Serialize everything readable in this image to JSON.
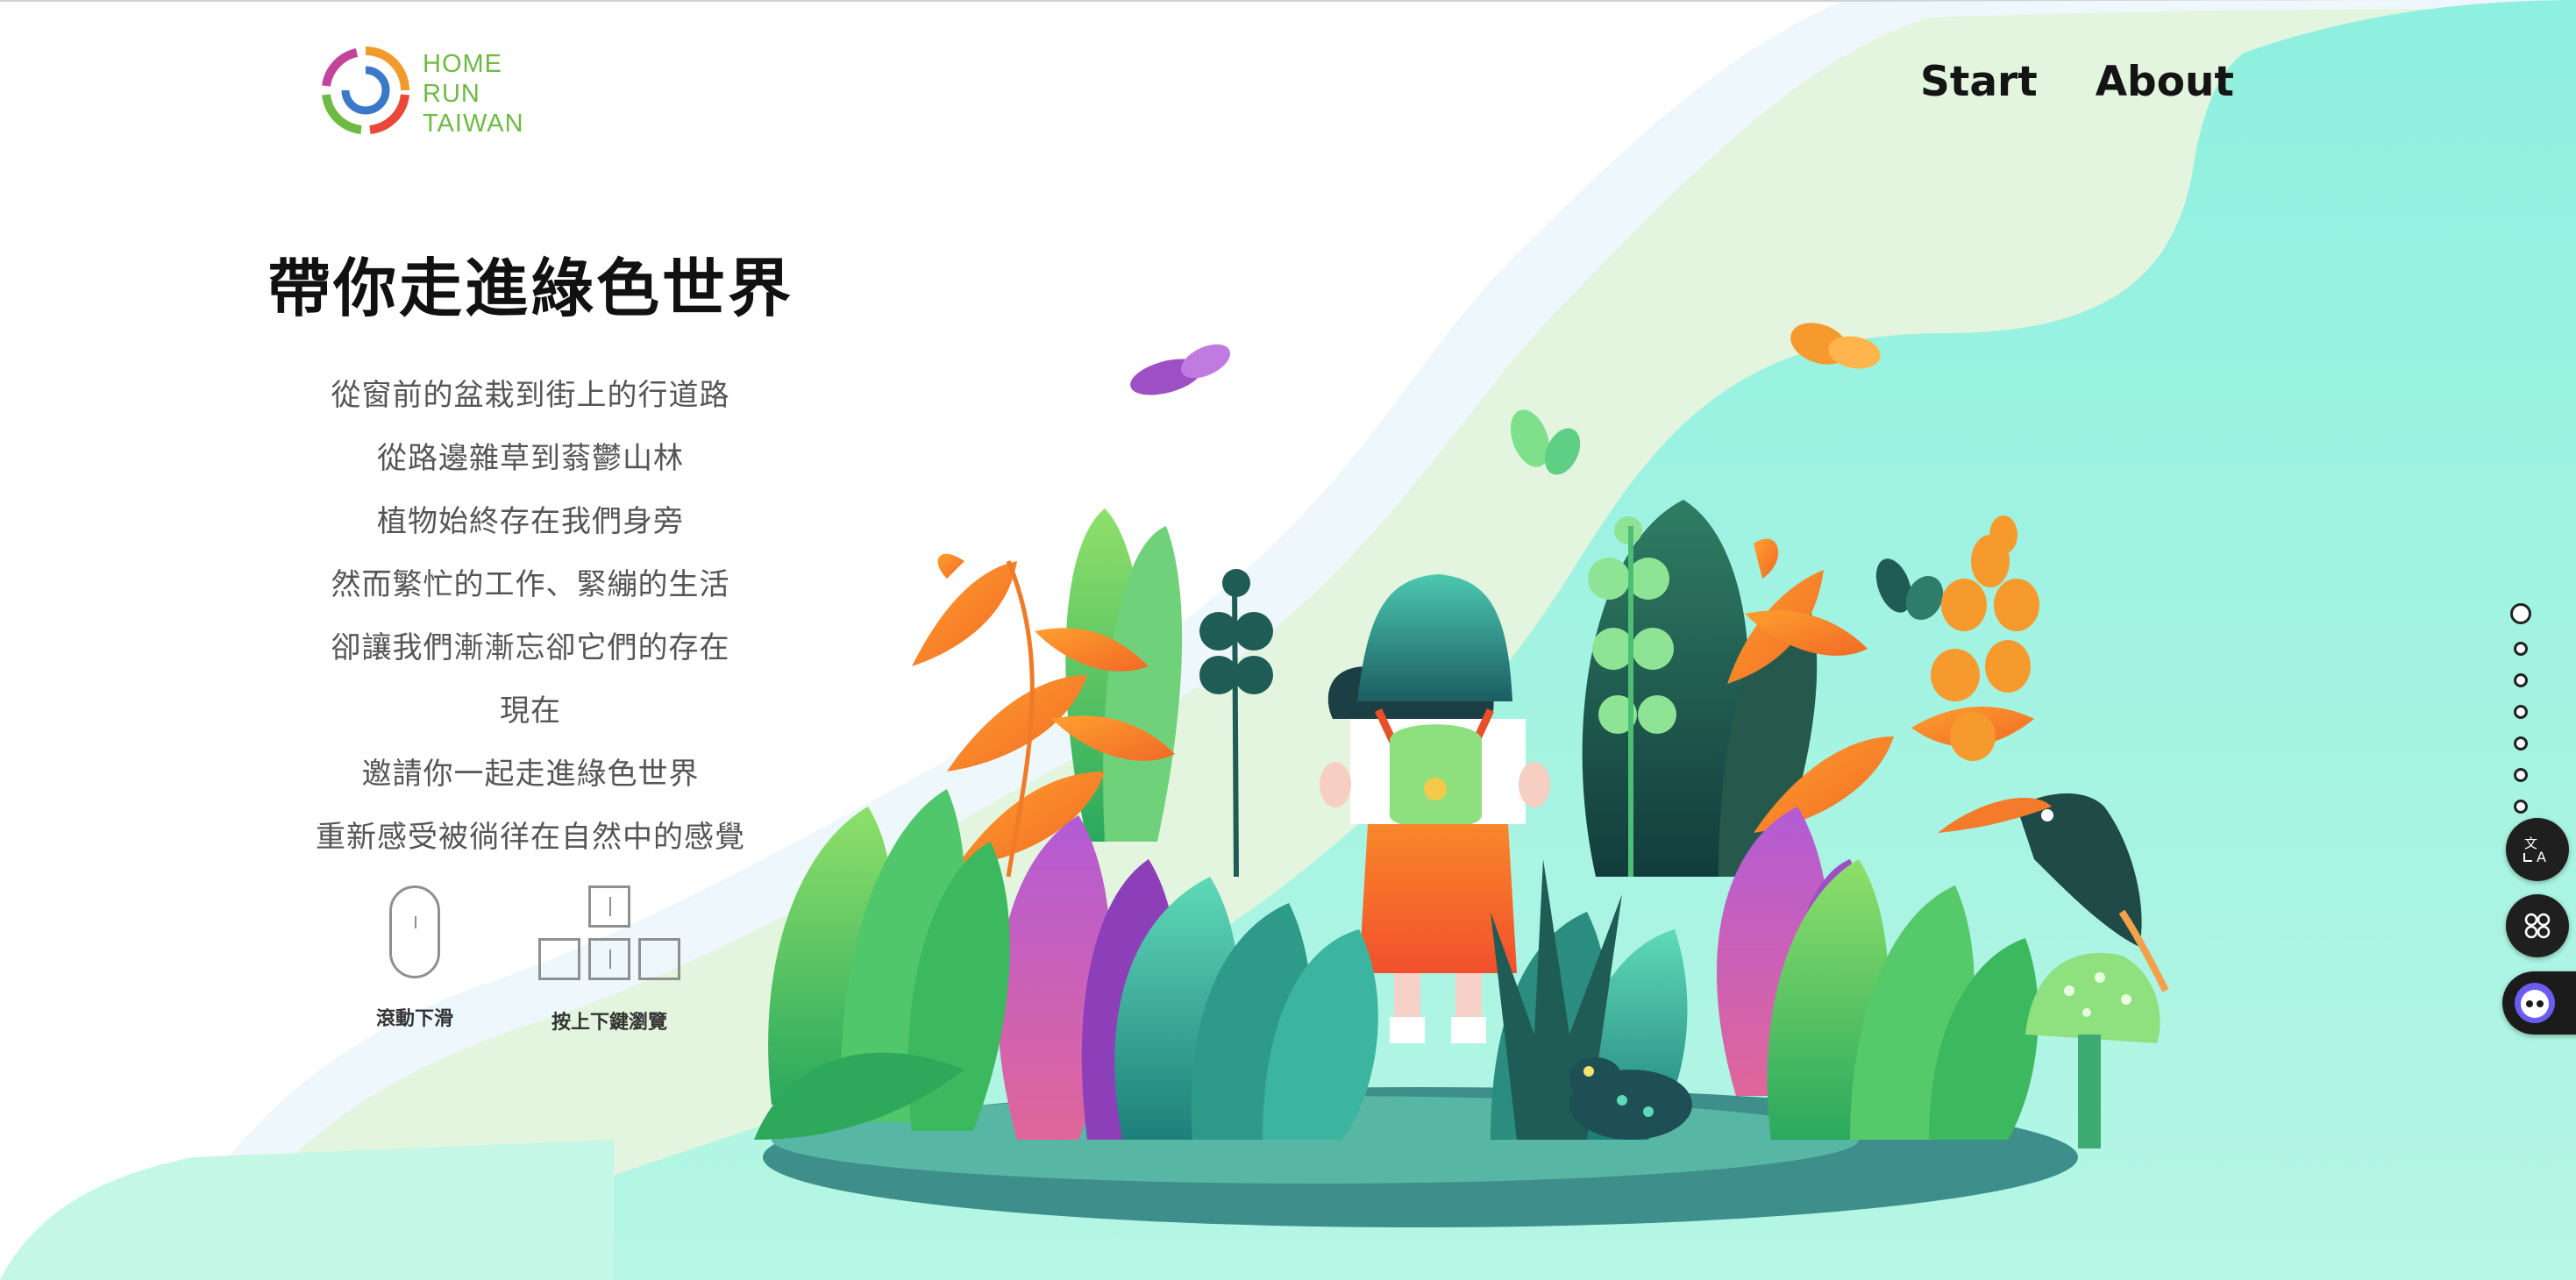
{
  "logo": {
    "lines": [
      "HOME",
      "RUN",
      "TAIWAN"
    ]
  },
  "nav": {
    "start": "Start",
    "about": "About"
  },
  "intro": {
    "title": "帶你走進綠色世界",
    "lines": [
      "從窗前的盆栽到街上的行道路",
      "從路邊雜草到蓊鬱山林",
      "植物始終存在我們身旁",
      "然而繁忙的工作、緊繃的生活",
      "卻讓我們漸漸忘卻它們的存在",
      "現在",
      "邀請你一起走進綠色世界",
      "重新感受被徜徉在自然中的感覺"
    ]
  },
  "hints": {
    "scroll": "滾動下滑",
    "keys": "按上下鍵瀏覽"
  },
  "pager": {
    "count": 7,
    "active": 1
  },
  "floating_buttons": {
    "translate_icon": "translate-icon",
    "apps_icon": "apps-icon",
    "assistant_icon": "assistant-icon"
  },
  "colors": {
    "mint": "#9ff2dd",
    "aqua": "#8ff0e1",
    "pale_green": "#e3f5df",
    "orange": "#f79a2e",
    "purple": "#9d4fc4",
    "dark_teal": "#1f5c55"
  }
}
